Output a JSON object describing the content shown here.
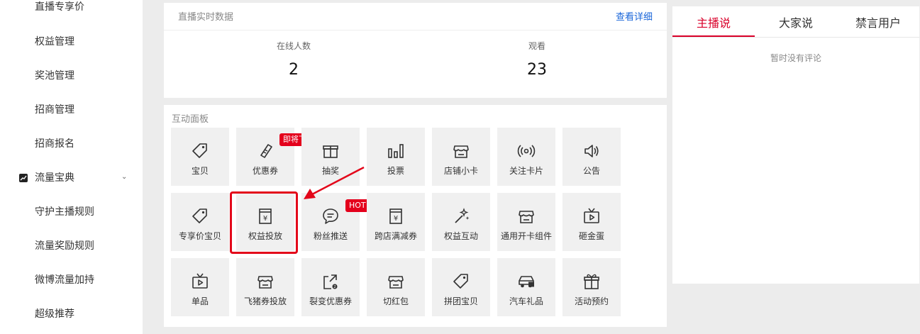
{
  "sidebar": {
    "items": [
      {
        "label": "直播专享价"
      },
      {
        "label": "权益管理"
      },
      {
        "label": "奖池管理"
      },
      {
        "label": "招商管理"
      },
      {
        "label": "招商报名"
      }
    ],
    "group": {
      "label": "流量宝典",
      "chevron": "⌄"
    },
    "sub_items": [
      {
        "label": "守护主播规则"
      },
      {
        "label": "流量奖励规则"
      },
      {
        "label": "微博流量加持"
      },
      {
        "label": "超级推荐"
      }
    ]
  },
  "live_data": {
    "title": "直播实时数据",
    "detail_link": "查看详细",
    "stats": [
      {
        "label": "在线人数",
        "value": "2"
      },
      {
        "label": "观看",
        "value": "23"
      }
    ]
  },
  "panel": {
    "title": "互动面板",
    "tiles": [
      {
        "label": "宝贝",
        "icon": "tag-icon"
      },
      {
        "label": "优惠券",
        "icon": "ticket-icon",
        "badge": "即将下线"
      },
      {
        "label": "抽奖",
        "icon": "gift-box-icon"
      },
      {
        "label": "投票",
        "icon": "bar-chart-icon"
      },
      {
        "label": "店铺小卡",
        "icon": "shop-icon"
      },
      {
        "label": "关注卡片",
        "icon": "broadcast-icon"
      },
      {
        "label": "公告",
        "icon": "speaker-icon"
      },
      {
        "label": "专享价宝贝",
        "icon": "tag-icon"
      },
      {
        "label": "权益投放",
        "icon": "yen-box-icon",
        "highlighted": true
      },
      {
        "label": "粉丝推送",
        "icon": "chat-bubble-icon",
        "badge": "HOT"
      },
      {
        "label": "跨店满减券",
        "icon": "yen-box-icon"
      },
      {
        "label": "权益互动",
        "icon": "magic-wand-icon"
      },
      {
        "label": "通用开卡组件",
        "icon": "shop-icon"
      },
      {
        "label": "砸金蛋",
        "icon": "tv-play-icon"
      },
      {
        "label": "单品",
        "icon": "tv-play-icon"
      },
      {
        "label": "飞猪券投放",
        "icon": "shop-icon"
      },
      {
        "label": "裂变优惠券",
        "icon": "share-icon"
      },
      {
        "label": "切红包",
        "icon": "shop-icon"
      },
      {
        "label": "拼团宝贝",
        "icon": "tag-icon"
      },
      {
        "label": "汽车礼品",
        "icon": "car-icon"
      },
      {
        "label": "活动预约",
        "icon": "gift-icon"
      }
    ]
  },
  "comments": {
    "tabs": [
      {
        "label": "主播说",
        "active": true
      },
      {
        "label": "大家说"
      },
      {
        "label": "禁言用户"
      }
    ],
    "empty_text": "暂时没有评论"
  },
  "colors": {
    "accent": "#d9002a",
    "link": "#1a66d9",
    "badge": "#e4001c",
    "highlight": "#e3061a"
  }
}
